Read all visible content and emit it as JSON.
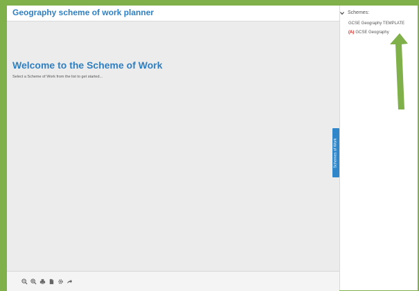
{
  "app": {
    "title": "Geography scheme of work planner"
  },
  "main": {
    "heading": "Welcome to the Scheme of Work",
    "subtitle": "Select a Scheme of Work from the list to get started..."
  },
  "side_tab": {
    "label": "Schemes of Work"
  },
  "toolbar": {
    "tools": [
      {
        "icon": "zoom-out-icon"
      },
      {
        "icon": "zoom-in-icon"
      },
      {
        "icon": "print-icon"
      },
      {
        "icon": "document-icon"
      },
      {
        "icon": "settings-icon"
      },
      {
        "icon": "share-icon"
      }
    ]
  },
  "schemes": {
    "header": "Schemes:",
    "items": [
      {
        "label": "GCSE Geography TEMPLATE",
        "badge": ""
      },
      {
        "label": "GCSE Geography",
        "badge": "(A)"
      }
    ]
  },
  "colors": {
    "frame_green": "#7fb04a",
    "title_blue": "#2f80c3",
    "tab_blue": "#2f86c8",
    "badge_red": "#d0211b",
    "arrow_green": "#7fb04a"
  }
}
